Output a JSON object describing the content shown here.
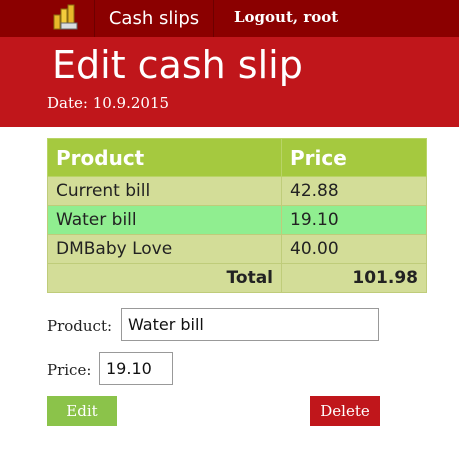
{
  "nav": {
    "logo_icon": "coins-stack-icon",
    "cash_slips_label": "Cash slips",
    "logout_label": "Logout, root"
  },
  "header": {
    "title": "Edit cash slip",
    "date": "Date: 10.9.2015"
  },
  "table": {
    "headers": [
      "Product",
      "Price"
    ],
    "rows": [
      {
        "product": "Current bill",
        "price": "42.88"
      },
      {
        "product": "Water bill",
        "price": "19.10"
      },
      {
        "product": "DMBaby Love",
        "price": "40.00"
      }
    ],
    "total_label": "Total",
    "total_value": "101.98"
  },
  "form": {
    "product_label": "Product:",
    "product_value": "Water bill",
    "price_label": "Price:",
    "price_value": "19.10",
    "edit_label": "Edit",
    "delete_label": "Delete"
  },
  "colors": {
    "nav_bg": "#8b0000",
    "header_bg": "#c0161b",
    "table_header": "#a5c93f",
    "row_bg": "#d3dd98",
    "selected_row": "#90ee90",
    "edit_button": "#8bc34a",
    "delete_button": "#c0161b"
  }
}
